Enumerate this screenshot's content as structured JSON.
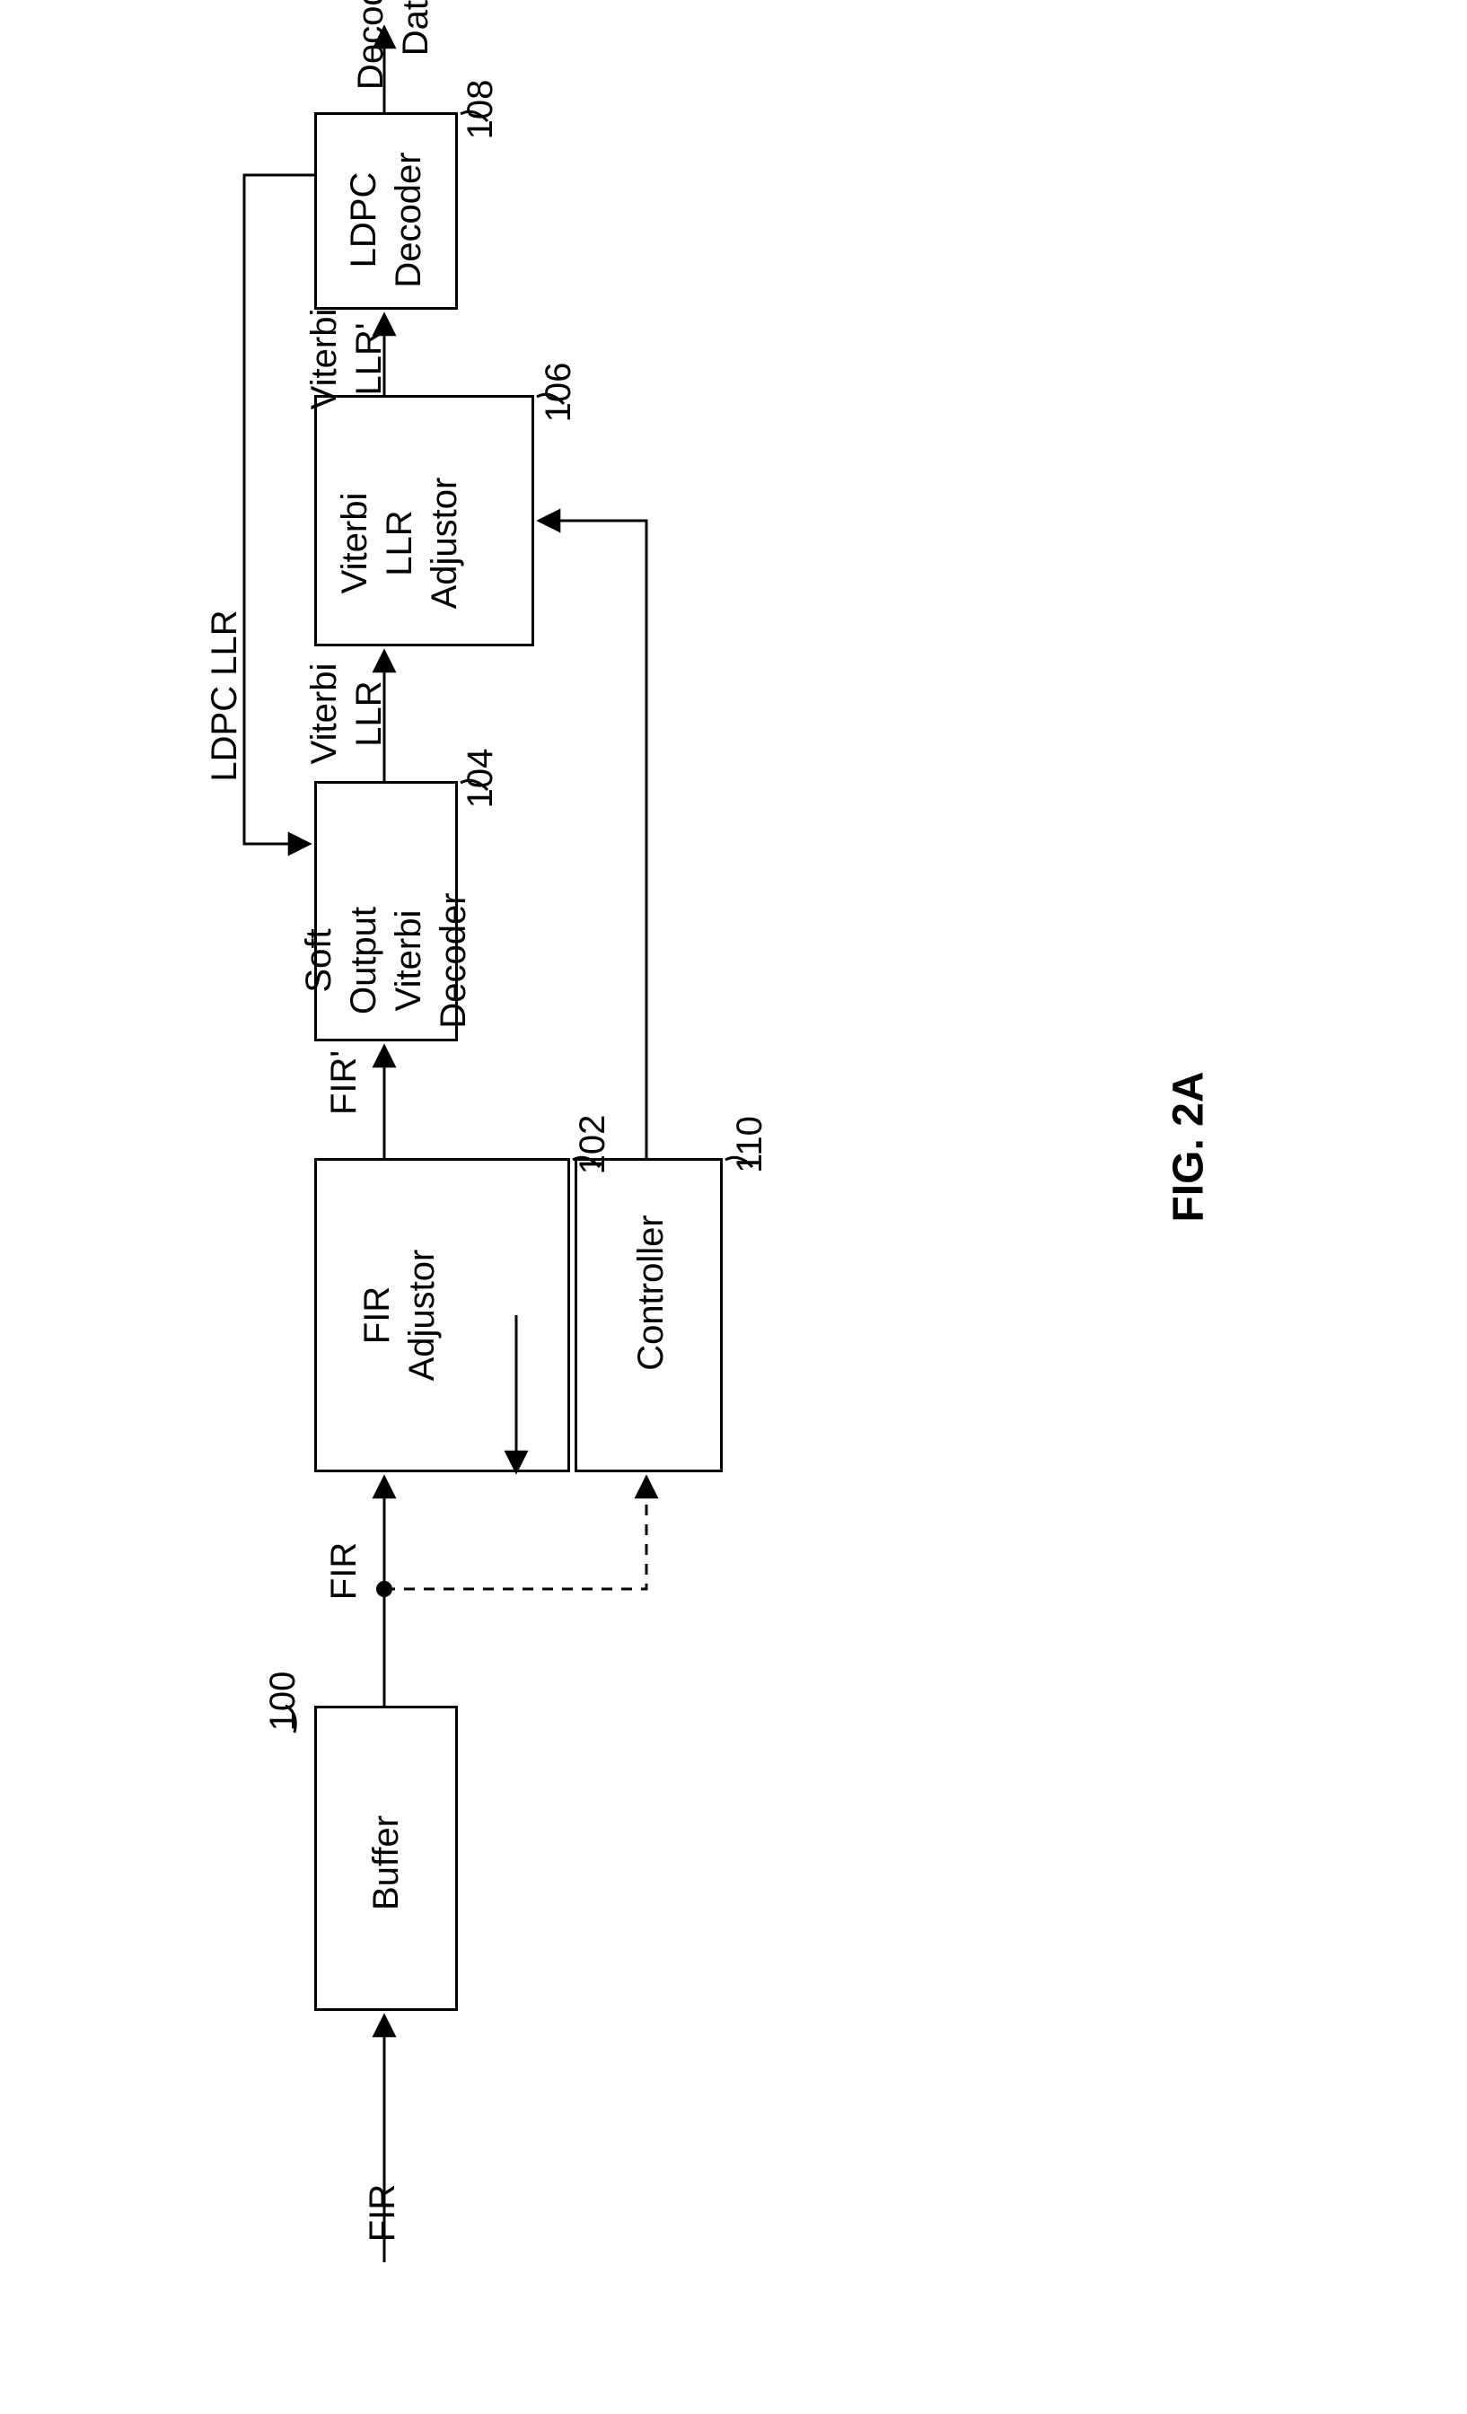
{
  "figure_caption": "FIG. 2A",
  "input_label": "FIR",
  "output_label": "Decoded\nData",
  "feedback_label": "LDPC LLR",
  "blocks": {
    "buffer": {
      "label": "Buffer",
      "ref": "100"
    },
    "fir_adjustor": {
      "label": "FIR\nAdjustor",
      "ref": "102"
    },
    "sovd": {
      "label": "Soft\nOutput\nViterbi\nDecoder",
      "ref": "104"
    },
    "llr_adjustor": {
      "label": "Viterbi\nLLR\nAdjustor",
      "ref": "106"
    },
    "ldpc": {
      "label": "LDPC\nDecoder",
      "ref": "108"
    },
    "controller": {
      "label": "Controller",
      "ref": "110"
    }
  },
  "signals": {
    "buf_to_firadj": "FIR",
    "firadj_to_sovd": "FIR'",
    "sovd_to_llradj": "Viterbi\nLLR",
    "llradj_to_ldpc": "Viterbi\nLLR'"
  }
}
